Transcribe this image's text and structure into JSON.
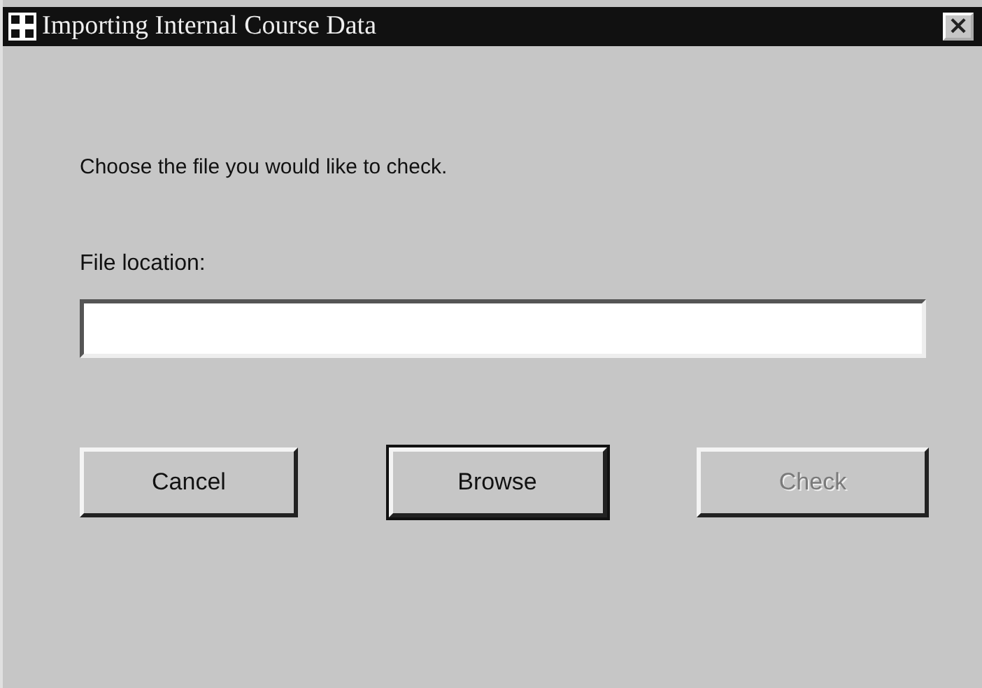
{
  "window": {
    "title": "Importing Internal Course Data",
    "close": "×"
  },
  "instruction": "Choose the file you would like to check.",
  "file_field": {
    "label": "File location:"
  },
  "buttons": [
    {
      "label": "Cancel",
      "focused": false,
      "disabled": false
    },
    {
      "label": "Browse",
      "focused": true,
      "disabled": false
    },
    {
      "label": "Check",
      "focused": false,
      "disabled": true
    }
  ]
}
